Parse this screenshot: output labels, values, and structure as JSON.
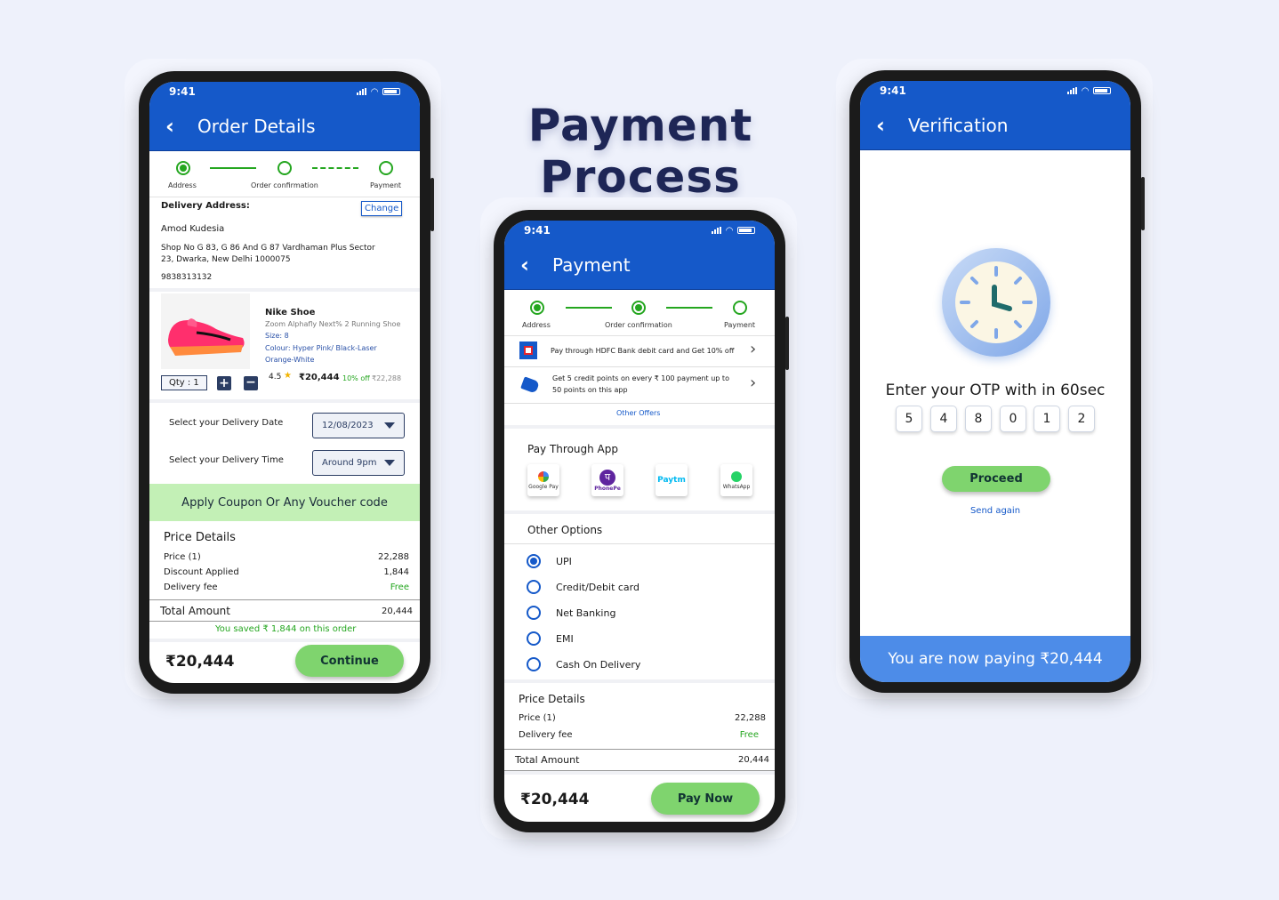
{
  "title": "Payment Process",
  "status_time": "9:41",
  "order": {
    "header": "Order Details",
    "steps": [
      "Address",
      "Order confirmation",
      "Payment"
    ],
    "delivery_label": "Delivery Address:",
    "change_label": "Change",
    "name": "Amod Kudesia",
    "address_line1": "Shop No G 83, G 86 And G 87 Vardhaman Plus Sector",
    "address_line2": "23, Dwarka, New Delhi 1000075",
    "phone": "9838313132",
    "product": {
      "name": "Nike Shoe",
      "model": "Zoom Alphafly Next% 2 Running Shoe",
      "size": "Size: 8",
      "colour_line1": "Colour: Hyper Pink/ Black-Laser",
      "colour_line2": "Orange-White",
      "rating": "4.5",
      "price": "₹20,444",
      "discount": "10% off",
      "mrp": "₹22,288",
      "qty": "Qty : 1"
    },
    "date_label": "Select your Delivery Date",
    "date_value": "12/08/2023",
    "time_label": "Select your Delivery Time",
    "time_value": "Around 9pm",
    "coupon": "Apply Coupon Or Any Voucher code",
    "price_details_title": "Price Details",
    "price_label": "Price (1)",
    "price_value": "22,288",
    "discount_label": "Discount Applied",
    "discount_value": "1,844",
    "delivery_label2": "Delivery fee",
    "delivery_value": "Free",
    "total_label": "Total Amount",
    "total_value": "20,444",
    "saved": "You saved ₹ 1,844 on this order",
    "footer_amount": "₹20,444",
    "continue_label": "Continue"
  },
  "payment": {
    "header": "Payment",
    "steps": [
      "Address",
      "Order confirmation",
      "Payment"
    ],
    "offer1": "Pay through HDFC Bank debit card and Get 10% off",
    "offer2_line1": "Get 5 credit points on every ₹ 100 payment up to",
    "offer2_line2": "50 points on this app",
    "other_offers": "Other Offers",
    "pay_through_app": "Pay Through App",
    "apps": [
      "Google Pay",
      "PhonePe",
      "Paytm",
      "WhatsApp"
    ],
    "other_options_title": "Other Options",
    "options": [
      "UPI",
      "Credit/Debit card",
      "Net Banking",
      "EMI",
      "Cash On Delivery"
    ],
    "selected_option": "UPI",
    "price_details_title": "Price Details",
    "price_label": "Price (1)",
    "price_value": "22,288",
    "delivery_label": "Delivery fee",
    "delivery_value": "Free",
    "total_label": "Total Amount",
    "total_value": "20,444",
    "footer_amount": "₹20,444",
    "pay_now_label": "Pay Now"
  },
  "verification": {
    "header": "Verification",
    "otp_prompt": "Enter your OTP with in 60sec",
    "otp_digits": [
      "5",
      "4",
      "8",
      "0",
      "1",
      "2"
    ],
    "proceed_label": "Proceed",
    "send_again": "Send again",
    "paying_banner": "You are now paying ₹20,444"
  },
  "colors": {
    "primary": "#1559c9",
    "accent_green": "#7fd46e",
    "step_green": "#24a61f",
    "title": "#1e2656"
  }
}
